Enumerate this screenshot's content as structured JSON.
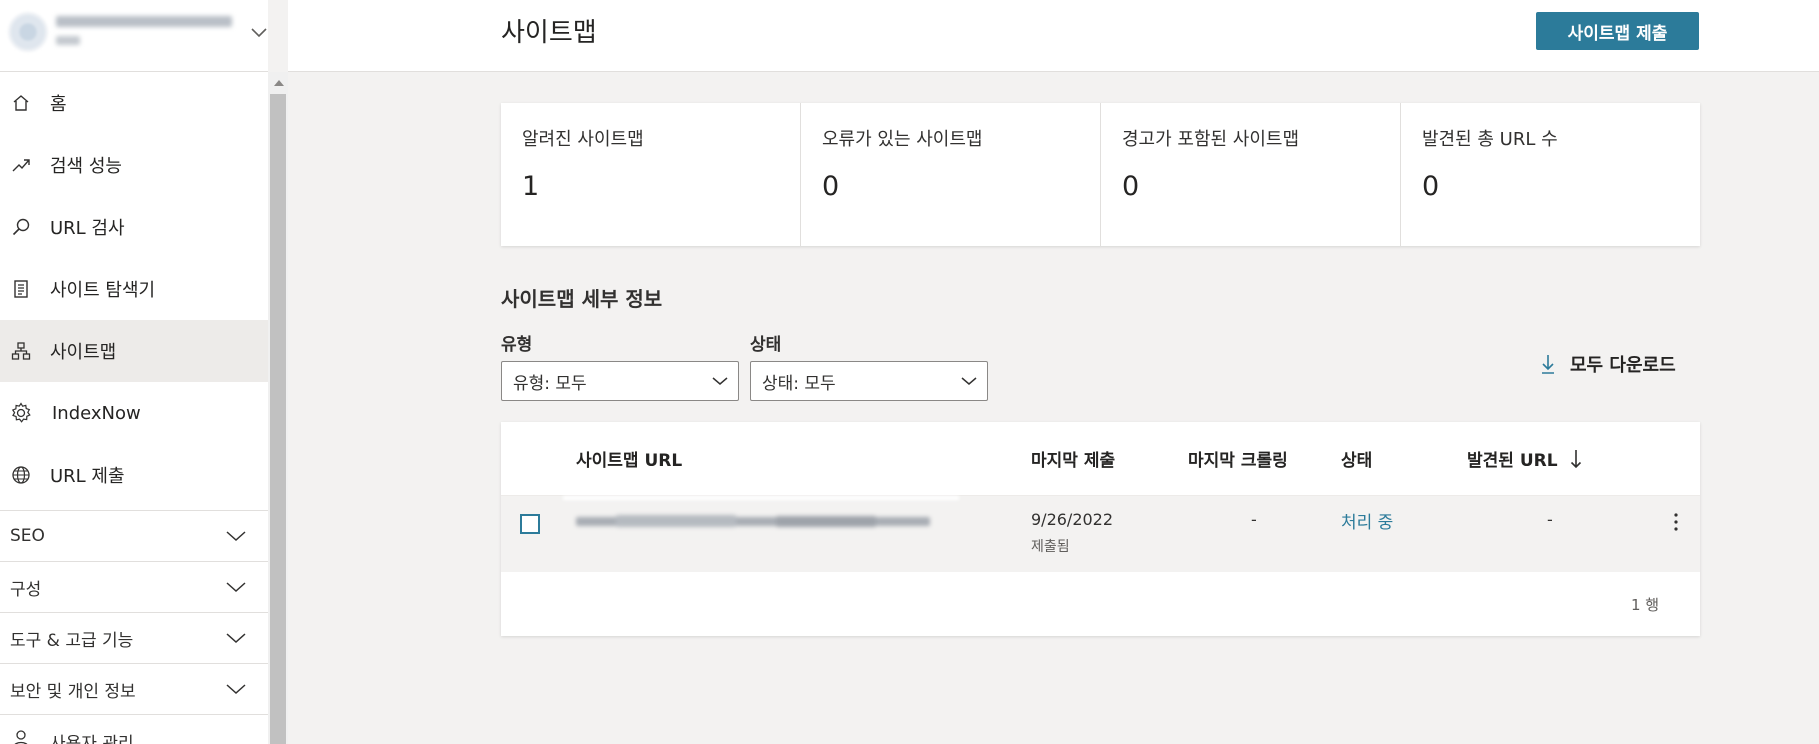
{
  "app": {
    "accent_color": "#2c7b9a",
    "site_name": "",
    "site_favicon": "site-favicon"
  },
  "sidebar": {
    "items": [
      {
        "label": "홈",
        "icon": "home-icon",
        "active": false
      },
      {
        "label": "검색 성능",
        "icon": "trend-up-icon",
        "active": false
      },
      {
        "label": "URL 검사",
        "icon": "search-icon",
        "active": false
      },
      {
        "label": "사이트 탐색기",
        "icon": "document-list-icon",
        "active": false
      },
      {
        "label": "사이트맵",
        "icon": "sitemap-icon",
        "active": true
      },
      {
        "label": "IndexNow",
        "icon": "gear-icon",
        "active": false
      },
      {
        "label": "URL 제출",
        "icon": "globe-icon",
        "active": false
      }
    ],
    "sections": [
      {
        "label": "SEO"
      },
      {
        "label": "구성"
      },
      {
        "label": "도구 & 고급 기능"
      },
      {
        "label": "보안 및 개인 정보"
      }
    ],
    "partial_item": {
      "label": "사용자 관리",
      "icon": "user-icon"
    }
  },
  "header": {
    "title": "사이트맵",
    "submit_button": "사이트맵 제출"
  },
  "stats": [
    {
      "label": "알려진 사이트맵",
      "value": "1"
    },
    {
      "label": "오류가 있는 사이트맵",
      "value": "0"
    },
    {
      "label": "경고가 포함된 사이트맵",
      "value": "0"
    },
    {
      "label": "발견된 총 URL 수",
      "value": "0"
    }
  ],
  "details": {
    "title": "사이트맵 세부 정보",
    "filters": {
      "type_label": "유형",
      "type_value": "유형: 모두",
      "status_label": "상태",
      "status_value": "상태: 모두"
    },
    "download_all": "모두 다운로드"
  },
  "table": {
    "headers": {
      "url": "사이트맵 URL",
      "last_submitted": "마지막 제출",
      "last_crawled": "마지막 크롤링",
      "status": "상태",
      "discovered_urls": "발견된 URL"
    },
    "sort_column": "discovered_urls",
    "sort_direction": "descending",
    "rows": [
      {
        "url": "",
        "last_submitted_date": "9/26/2022",
        "last_submitted_note": "제출됨",
        "last_crawled": "-",
        "status": "처리 중",
        "discovered_urls": "-"
      }
    ],
    "row_count": "1 행"
  }
}
